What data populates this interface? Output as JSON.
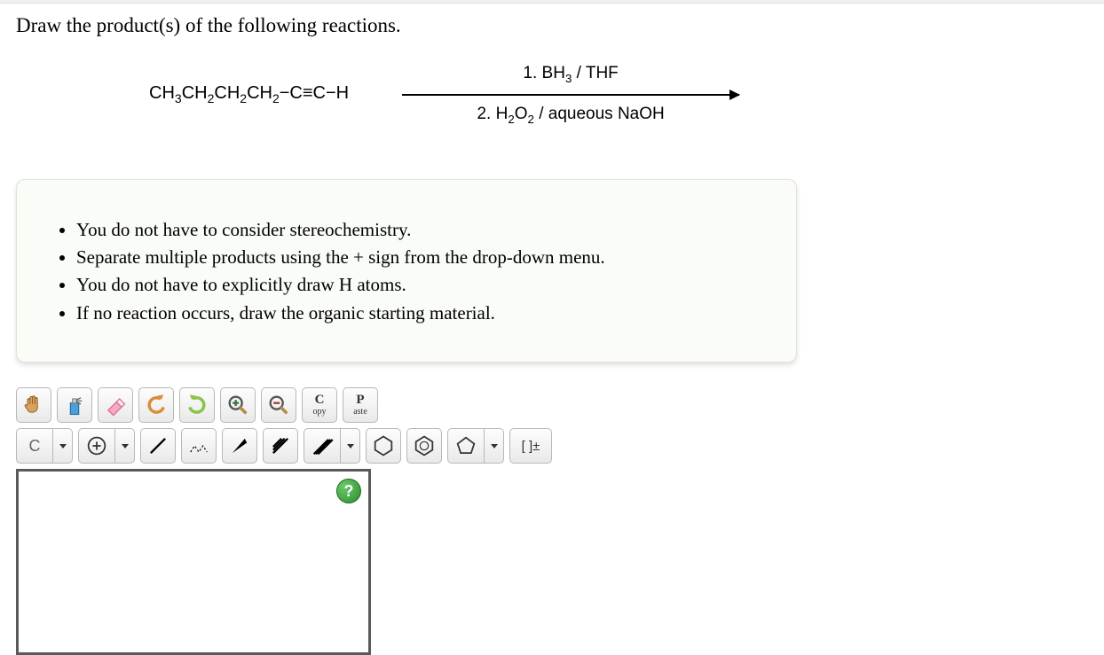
{
  "question": "Draw the product(s) of the following reactions.",
  "reaction": {
    "reactant_formula_html": "CH<sub>3</sub>CH<sub>2</sub>CH<sub>2</sub>CH<sub>2</sub>−C≡C−H",
    "reagent_top_html": "1. BH<sub>3</sub> / THF",
    "reagent_bottom_html": "2. H<sub>2</sub>O<sub>2</sub> / aqueous NaOH"
  },
  "instructions": [
    "You do not have to consider stereochemistry.",
    "Separate multiple products using the + sign from the drop-down menu.",
    "You do not have to explicitly draw H atoms.",
    "If no reaction occurs, draw the organic starting material."
  ],
  "toolbar": {
    "row1": {
      "hand": "✋",
      "clear": "🧹",
      "eraser": "eraser",
      "undo": "↶",
      "redo": "↷",
      "zoom_in": "+",
      "zoom_out": "−",
      "copy_top": "C",
      "copy_bot": "opy",
      "paste_top": "P",
      "paste_bot": "aste"
    },
    "row2": {
      "element": "C",
      "charge": "⊕",
      "single_bond": "/",
      "chain": "⋰",
      "wedge_solid": "◣",
      "wedge_hash": "⫽",
      "wedge_hash2": "⫽",
      "cyclohexane": "⬡",
      "benzene": "⌬",
      "cyclopentane": "⬠",
      "bracket": "[ ]±"
    }
  },
  "help": "?"
}
